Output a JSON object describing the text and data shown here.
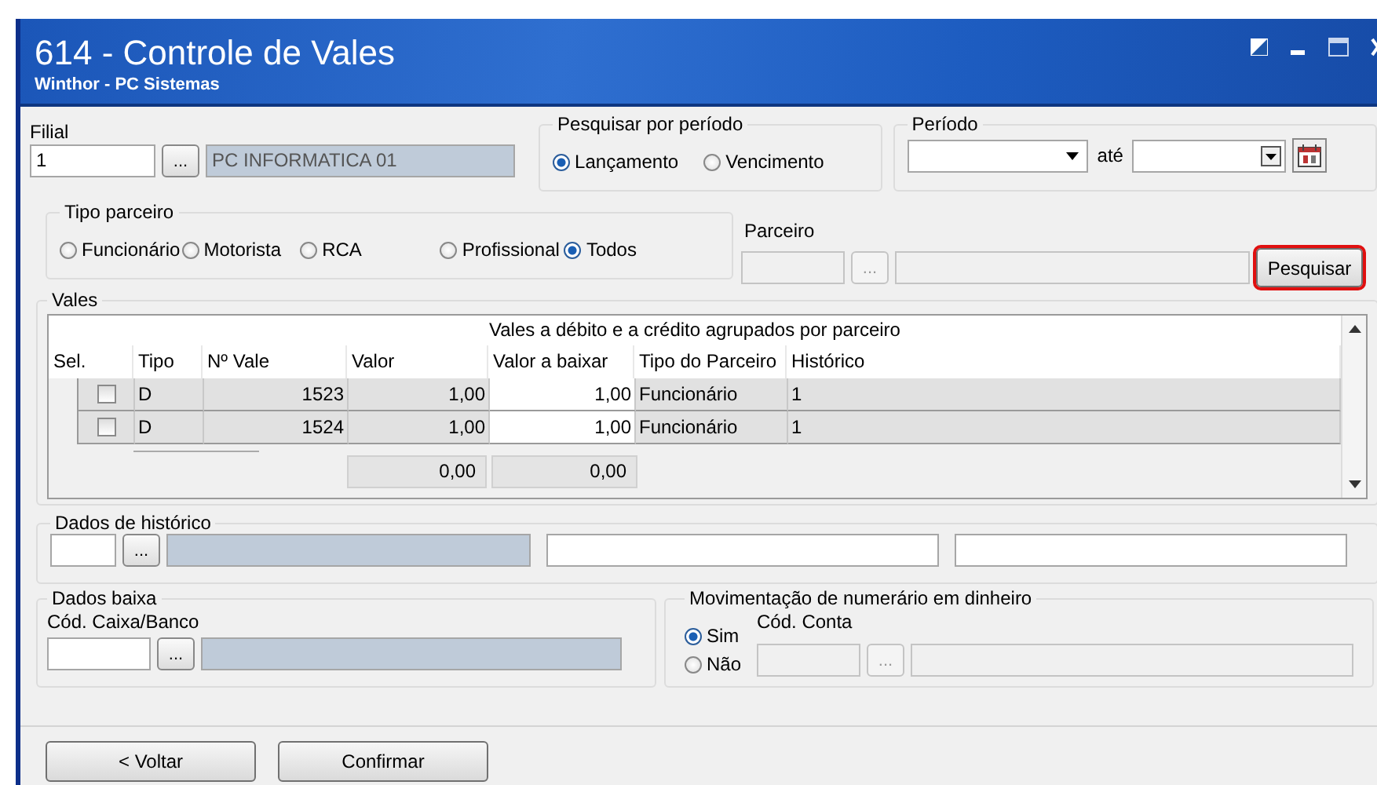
{
  "window": {
    "title": "614 - Controle de Vales",
    "subtitle": "Winthor - PC Sistemas"
  },
  "filial": {
    "label": "Filial",
    "code": "1",
    "lookup": "...",
    "name": "PC INFORMATICA 01"
  },
  "period_search": {
    "legend": "Pesquisar por período",
    "options": [
      {
        "label": "Lançamento",
        "selected": true
      },
      {
        "label": "Vencimento",
        "selected": false
      }
    ]
  },
  "period": {
    "legend": "Período",
    "until_label": "até"
  },
  "partner_type": {
    "legend": "Tipo parceiro",
    "options": [
      {
        "label": "Funcionário",
        "selected": false
      },
      {
        "label": "Motorista",
        "selected": false
      },
      {
        "label": "RCA",
        "selected": false
      },
      {
        "label": "Profissional",
        "selected": false
      },
      {
        "label": "Todos",
        "selected": true
      }
    ]
  },
  "partner": {
    "label": "Parceiro",
    "lookup": "...",
    "button": "Pesquisar",
    "highlighted": true
  },
  "vales": {
    "legend": "Vales",
    "caption": "Vales a débito e a crédito agrupados por parceiro",
    "columns": [
      "Sel.",
      "Tipo",
      "Nº Vale",
      "Valor",
      "Valor a baixar",
      "Tipo do Parceiro",
      "Histórico"
    ],
    "rows": [
      {
        "checked": false,
        "tipo": "D",
        "numero": "1523",
        "valor": "1,00",
        "valor_baixar": "1,00",
        "tipo_parceiro": "Funcionário",
        "historico": "1"
      },
      {
        "checked": false,
        "tipo": "D",
        "numero": "1524",
        "valor": "1,00",
        "valor_baixar": "1,00",
        "tipo_parceiro": "Funcionário",
        "historico": "1"
      }
    ],
    "totals": {
      "valor": "0,00",
      "valor_baixar": "0,00"
    }
  },
  "history": {
    "legend": "Dados de histórico",
    "lookup": "..."
  },
  "baixa": {
    "legend": "Dados baixa",
    "label": "Cód. Caixa/Banco",
    "lookup": "..."
  },
  "cash_movement": {
    "legend": "Movimentação de numerário em dinheiro",
    "options": [
      {
        "label": "Sim",
        "selected": true
      },
      {
        "label": "Não",
        "selected": false
      }
    ],
    "account_label": "Cód. Conta",
    "lookup": "..."
  },
  "buttons": [
    "< Voltar",
    "Confirmar"
  ]
}
